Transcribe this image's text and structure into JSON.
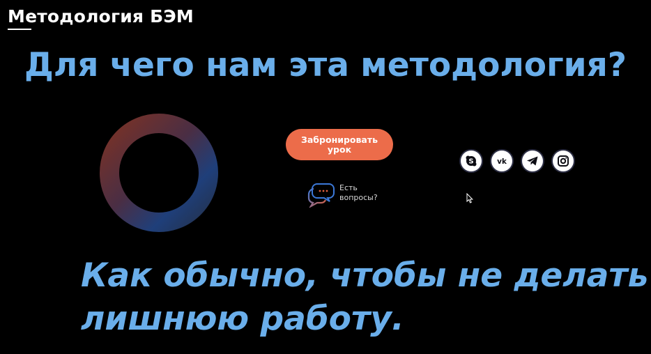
{
  "header": {
    "title": "Методология БЭМ"
  },
  "slide": {
    "headline": "Для чего нам эта методология?",
    "subtitle_line1": "Как обычно, чтобы не делать",
    "subtitle_line2": "лишнюю работу."
  },
  "page": {
    "book_button_label": "Забронировать урок",
    "questions_label": "Есть\nвопросы?",
    "questions_icon": "chat-bubbles-icon",
    "social_icons": [
      "skype-icon",
      "vk-icon",
      "telegram-icon",
      "instagram-icon"
    ]
  },
  "colors": {
    "accent_blue": "#6aaeea",
    "button_orange": "#ec6c4a",
    "ring_gradient_start": "#7a3226",
    "ring_gradient_end": "#1f3f7a"
  }
}
